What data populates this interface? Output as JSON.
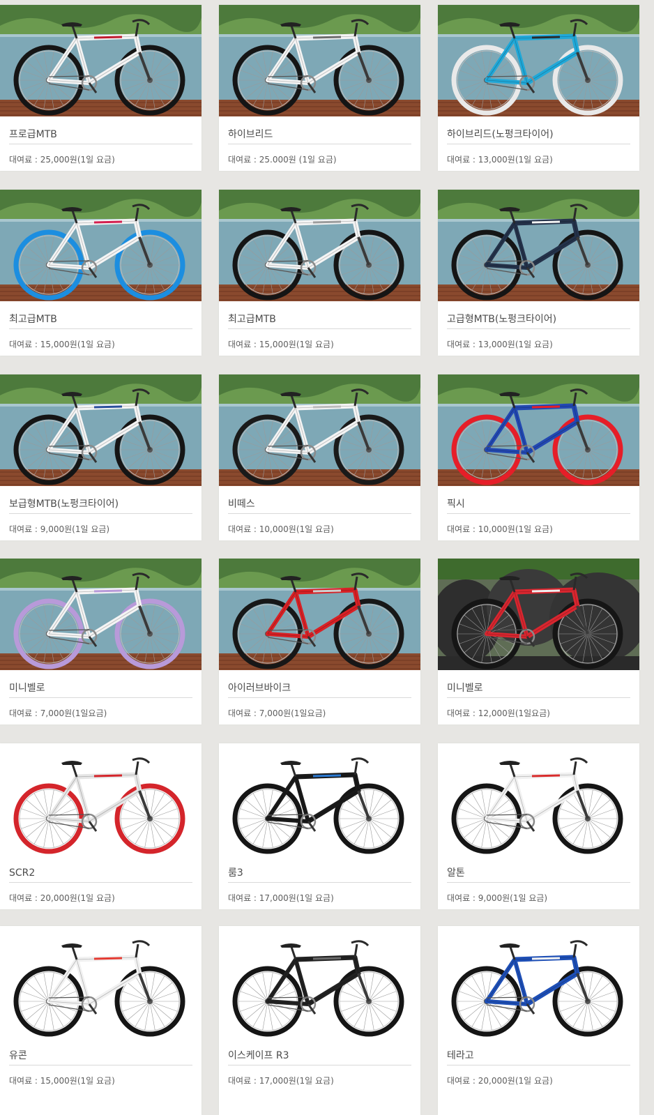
{
  "products": [
    {
      "name": "프로급MTB",
      "price": "대여료 : 25,000원(1일 요금)",
      "photo": "bike-on-blue-wall-photo",
      "frame_color": "#f4f4f4",
      "accent": "#c11b2e",
      "wheel_color": "#151515",
      "background": "wall"
    },
    {
      "name": "하이브리드",
      "price": "대여료 : 25.000원 (1일 요금)",
      "photo": "bike-on-blue-wall-photo",
      "frame_color": "#f4f4f4",
      "accent": "#6d6d6d",
      "wheel_color": "#151515",
      "background": "wall"
    },
    {
      "name": "하이브리드(노펑크타이어)",
      "price": "대여료 : 13,000원(1일 요금)",
      "photo": "bike-on-blue-wall-photo",
      "frame_color": "#20a8d8",
      "accent": "#2a2a2a",
      "wheel_color": "#e9e9e9",
      "background": "wall"
    },
    {
      "name": "최고급MTB",
      "price": "대여료 : 15,000원(1일 요금)",
      "photo": "bike-on-blue-wall-photo",
      "frame_color": "#f4f4f4",
      "accent": "#d41f4f",
      "wheel_color": "#1c8ee0",
      "background": "wall"
    },
    {
      "name": "최고급MTB",
      "price": "대여료 : 15,000원(1일 요금)",
      "photo": "bike-on-blue-wall-photo",
      "frame_color": "#f4f4f4",
      "accent": "#9d9d9d",
      "wheel_color": "#151515",
      "background": "wall"
    },
    {
      "name": "고급형MTB(노펑크타이어)",
      "price": "대여료 : 13,000원(1일 요금)",
      "photo": "bike-on-blue-wall-photo",
      "frame_color": "#24324a",
      "accent": "#f4f4f4",
      "wheel_color": "#151515",
      "background": "wall"
    },
    {
      "name": "보급형MTB(노펑크타이어)",
      "price": "대여료 : 9,000원(1일 요금)",
      "photo": "bike-on-blue-wall-photo",
      "frame_color": "#f4f4f4",
      "accent": "#2a4f9e",
      "wheel_color": "#151515",
      "background": "wall"
    },
    {
      "name": "비떼스",
      "price": "대여료 : 10,000원(1일 요금)",
      "photo": "bike-on-blue-wall-photo",
      "frame_color": "#f4f4f4",
      "accent": "#bbbbbb",
      "wheel_color": "#1a1a1a",
      "background": "wall"
    },
    {
      "name": "픽시",
      "price": "대여료 : 10,000원(1일 요금)",
      "photo": "bike-on-blue-wall-photo",
      "frame_color": "#2248b2",
      "accent": "#e61e28",
      "wheel_color": "#e61e28",
      "background": "wall"
    },
    {
      "name": "미니벨로",
      "price": "대여료 : 7,000원(1일요금)",
      "photo": "bike-on-blue-wall-photo",
      "frame_color": "#f4f4f4",
      "accent": "#b89ad9",
      "wheel_color": "#b89ad9",
      "background": "wall"
    },
    {
      "name": "아이러브바이크",
      "price": "대여료 : 7,000원(1일요금)",
      "photo": "bike-on-blue-wall-photo",
      "frame_color": "#d82125",
      "accent": "#cfcfcf",
      "wheel_color": "#171717",
      "background": "wall"
    },
    {
      "name": "미니벨로",
      "price": "대여료 : 12,000원(1일요금)",
      "photo": "bike-on-rocks-photo",
      "frame_color": "#d8262f",
      "accent": "#f0f0f0",
      "wheel_color": "#151515",
      "background": "rocks"
    },
    {
      "name": "SCR2",
      "price": "대여료 : 20,000원(1일 요금)",
      "photo": "bike-on-white-photo",
      "frame_color": "#e6e6e6",
      "accent": "#d4252b",
      "wheel_color": "#d4252b",
      "background": "white"
    },
    {
      "name": "룸3",
      "price": "대여료 : 17,000원(1일 요금)",
      "photo": "bike-on-white-photo",
      "frame_color": "#1a1a1a",
      "accent": "#2b7ad3",
      "wheel_color": "#151515",
      "background": "white"
    },
    {
      "name": "알톤",
      "price": "대여료 : 9,000원(1일 요금)",
      "photo": "bike-on-white-photo",
      "frame_color": "#f1f1f1",
      "accent": "#d82c2c",
      "wheel_color": "#151515",
      "background": "white"
    },
    {
      "name": "유콘",
      "price": "대여료 : 15,000원(1일 요금)",
      "photo": "bike-on-white-photo",
      "frame_color": "#f1f1f1",
      "accent": "#e43b32",
      "wheel_color": "#151515",
      "background": "white"
    },
    {
      "name": "이스케이프 R3",
      "price": "대여료 : 17,000원(1일 요금)",
      "photo": "bike-on-white-photo",
      "frame_color": "#222222",
      "accent": "#6b6b6b",
      "wheel_color": "#151515",
      "background": "white"
    },
    {
      "name": "테라고",
      "price": "대여료 : 20,000원(1일 요금)",
      "photo": "bike-on-white-photo",
      "frame_color": "#1e4fb6",
      "accent": "#f2f2f2",
      "wheel_color": "#151515",
      "background": "white"
    }
  ]
}
